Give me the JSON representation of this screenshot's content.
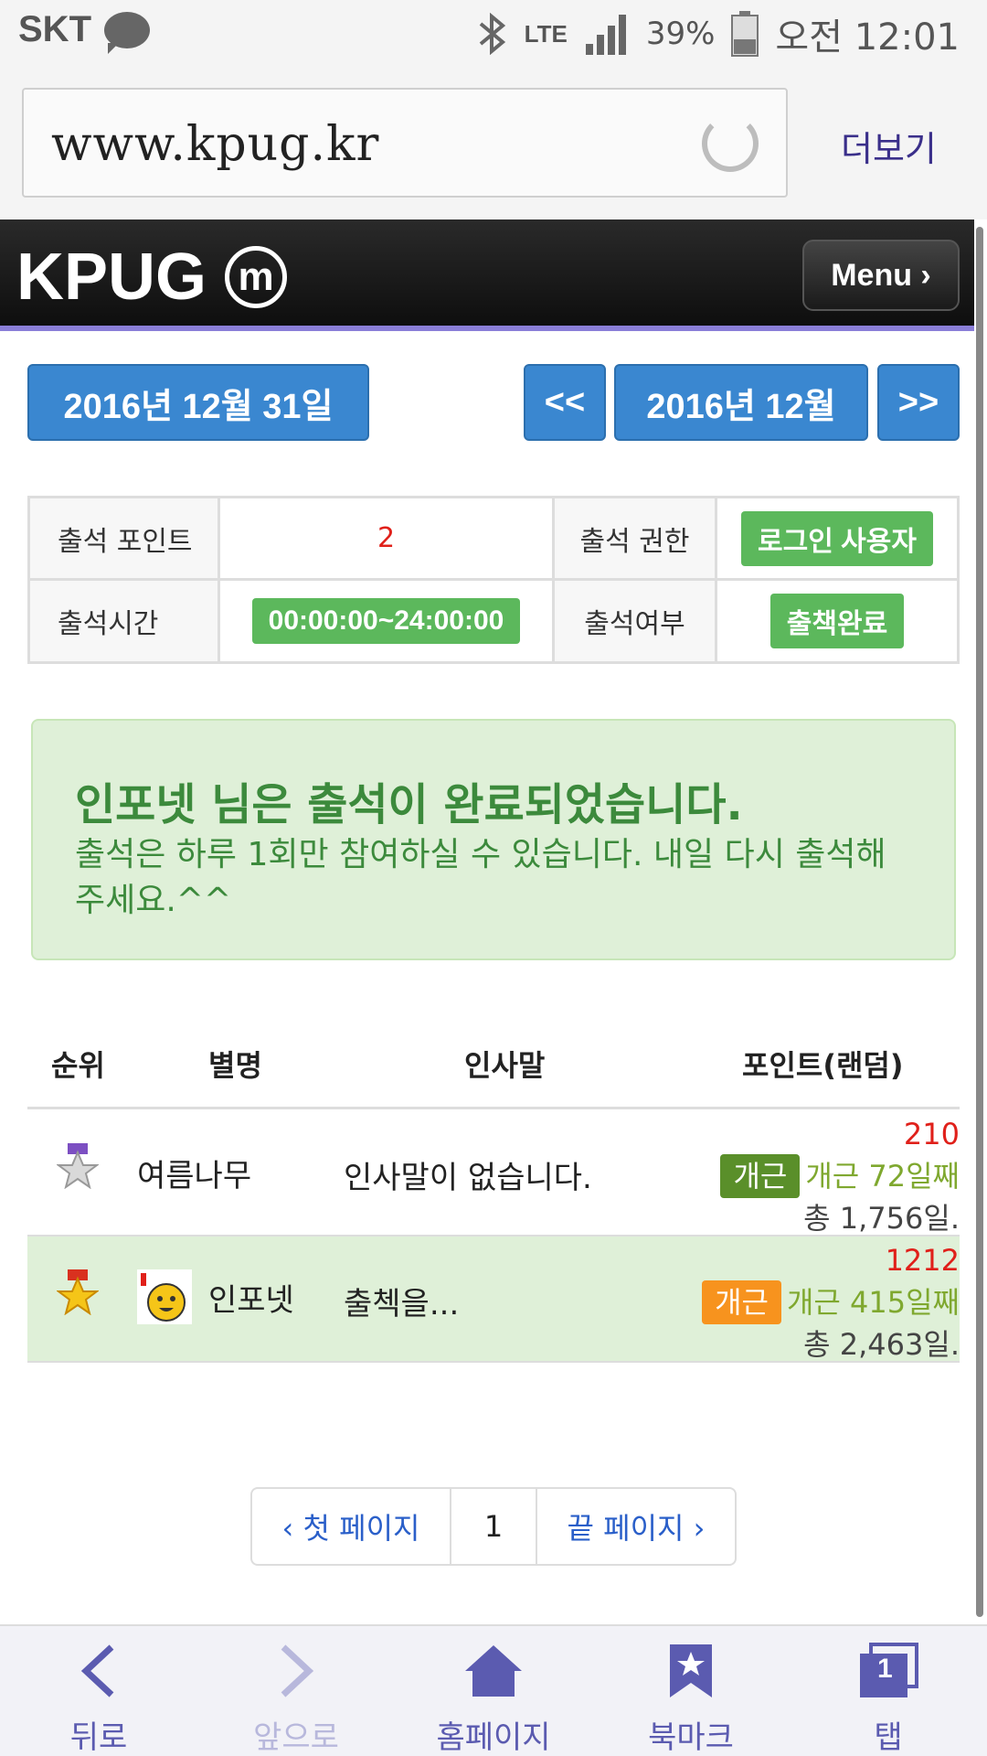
{
  "status": {
    "carrier": "SKT",
    "network": "LTE",
    "battery": "39%",
    "time": "오전 12:01"
  },
  "browser": {
    "url": "www.kpug.kr",
    "more_label": "더보기"
  },
  "header": {
    "logo": "KPUG",
    "logo_mark": "m",
    "menu_label": "Menu ›"
  },
  "dates": {
    "selected_date": "2016년 12월 31일",
    "prev_label": "<<",
    "month_label": "2016년 12월",
    "next_label": ">>"
  },
  "attendance_info": {
    "point_label": "출석 포인트",
    "point_value": "2",
    "permission_label": "출석 권한",
    "permission_value": "로그인 사용자",
    "time_label": "출석시간",
    "time_value": "00:00:00~24:00:00",
    "status_label": "출석여부",
    "status_value": "출책완료"
  },
  "alert": {
    "title": "인포넷 님은 출석이 완료되었습니다.",
    "body": "출석은 하루 1회만 참여하실 수 있습니다. 내일 다시 출석해 주세요.^^"
  },
  "ranking": {
    "headers": {
      "rank": "순위",
      "nickname": "별명",
      "greeting": "인사말",
      "points": "포인트(랜덤)"
    },
    "rows": [
      {
        "nickname": "여름나무",
        "greeting": "인사말이 없습니다.",
        "points": "210",
        "tag": "개근",
        "tag_color": "#5a8f2a",
        "streak": "개근 72일째",
        "total": "총 1,756일."
      },
      {
        "nickname": "인포넷",
        "greeting": "출첵을...",
        "points": "1212",
        "tag": "개근",
        "tag_color": "#f7931e",
        "streak": "개근 415일째",
        "total": "총 2,463일."
      }
    ]
  },
  "pagination": {
    "first": "‹ 첫 페이지",
    "current": "1",
    "last": "끝 페이지 ›"
  },
  "bottom_nav": {
    "back": "뒤로",
    "forward": "앞으로",
    "home": "홈페이지",
    "bookmark": "북마크",
    "tabs": "탭",
    "tab_count": "1"
  }
}
